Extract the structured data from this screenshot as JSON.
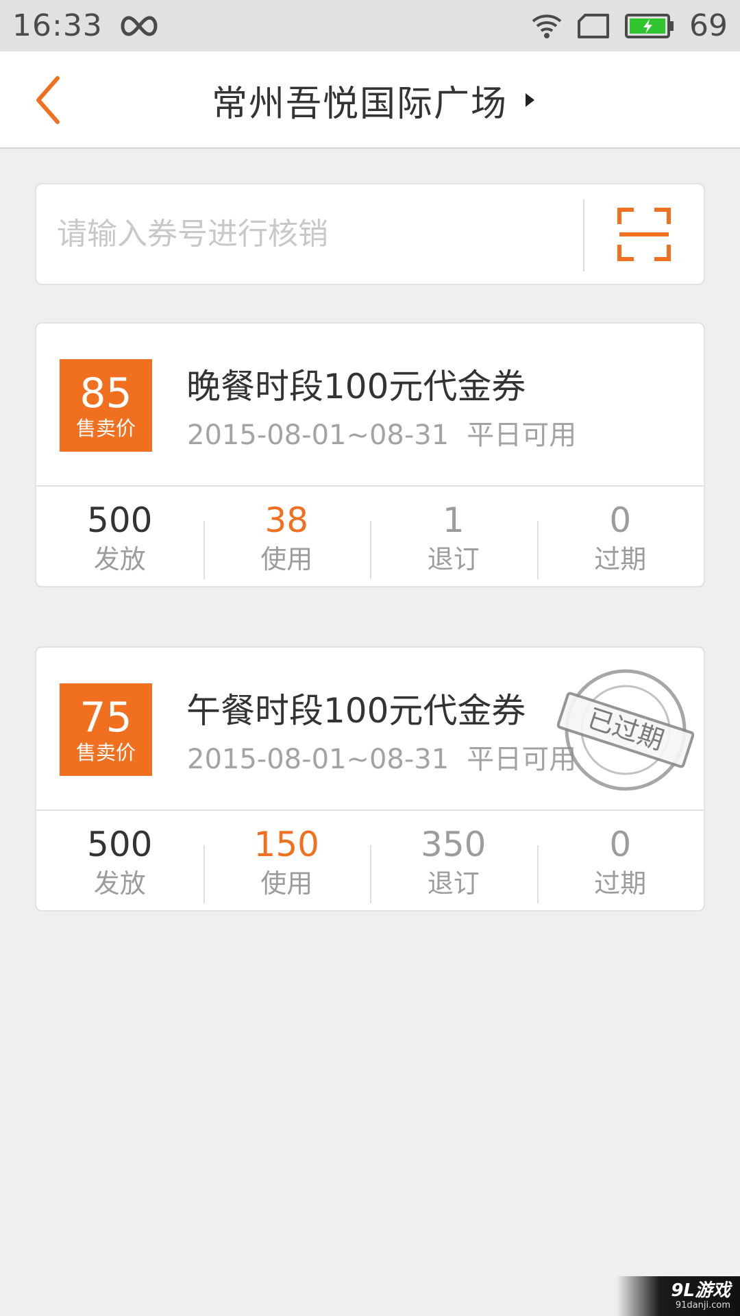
{
  "status_bar": {
    "time": "16:33",
    "battery_level": "69",
    "icons": [
      "infinity-icon",
      "wifi-icon",
      "sim-card-icon",
      "battery-charging-icon"
    ],
    "battery_color": "#2ec52e"
  },
  "header": {
    "title": "常州吾悦国际广场",
    "back_icon": "chevron-left-icon",
    "dropdown_icon": "triangle-right-icon"
  },
  "search": {
    "placeholder": "请输入券号进行核销",
    "value": "",
    "scan_icon": "scan-frame-icon"
  },
  "theme": {
    "accent": "#f07020",
    "background": "#efeff0"
  },
  "coupons": [
    {
      "price": "85",
      "price_label": "售卖价",
      "title": "晚餐时段100元代金券",
      "date_range": "2015-08-01~08-31",
      "usage": "平日可用",
      "expired": false,
      "stats": [
        {
          "value": "500",
          "label": "发放"
        },
        {
          "value": "38",
          "label": "使用"
        },
        {
          "value": "1",
          "label": "退订"
        },
        {
          "value": "0",
          "label": "过期"
        }
      ]
    },
    {
      "price": "75",
      "price_label": "售卖价",
      "title": "午餐时段100元代金券",
      "date_range": "2015-08-01~08-31",
      "usage": "平日可用",
      "expired": true,
      "stamp_text": "已过期",
      "stats": [
        {
          "value": "500",
          "label": "发放"
        },
        {
          "value": "150",
          "label": "使用"
        },
        {
          "value": "350",
          "label": "退订"
        },
        {
          "value": "0",
          "label": "过期"
        }
      ]
    }
  ],
  "watermark": {
    "logo": "9L游戏",
    "url": "91danji.com"
  }
}
